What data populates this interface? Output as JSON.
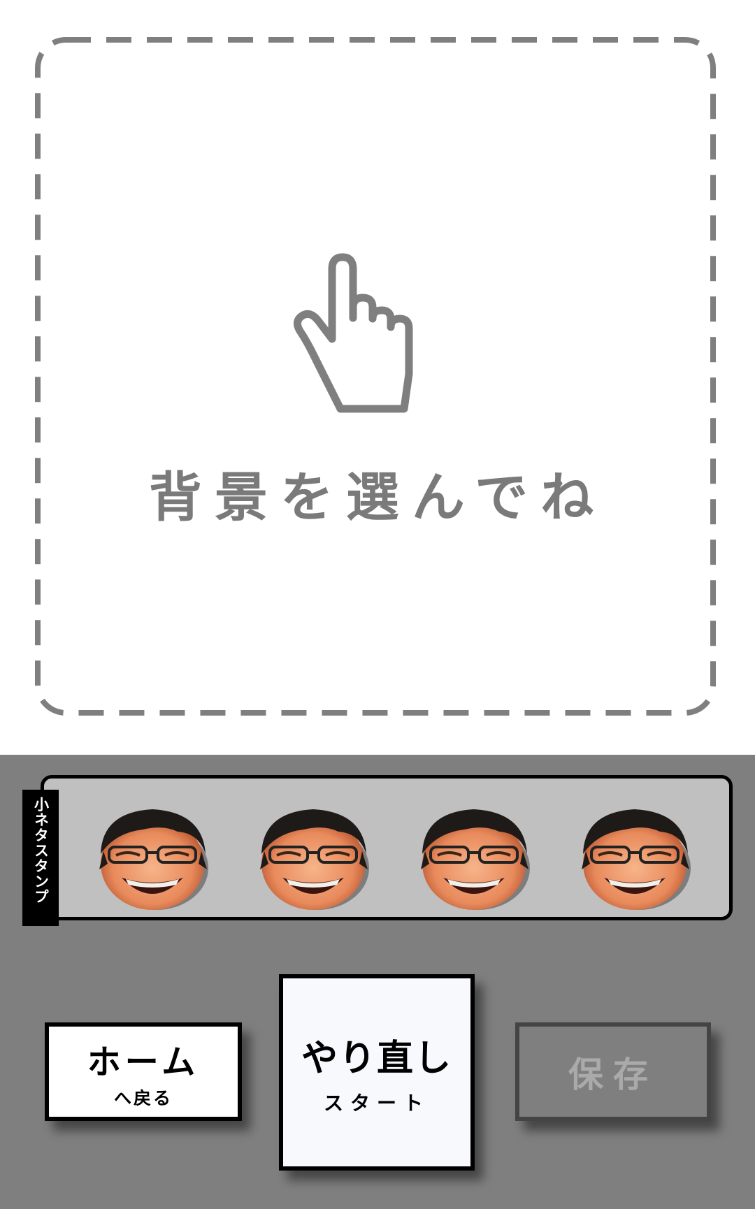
{
  "canvas": {
    "prompt": "背景を選んでね",
    "icon": "pointing-hand-icon"
  },
  "stamps": {
    "tab_label": "小ネタスタンプ",
    "items": [
      {
        "name": "laughing-face-stamp-1"
      },
      {
        "name": "laughing-face-stamp-2"
      },
      {
        "name": "laughing-face-stamp-3"
      },
      {
        "name": "laughing-face-stamp-4"
      }
    ]
  },
  "buttons": {
    "home": {
      "main": "ホーム",
      "sub": "へ戻る"
    },
    "redo": {
      "main": "やり直し",
      "sub": "スタート"
    },
    "save": {
      "main": "保存",
      "state": "disabled"
    }
  },
  "colors": {
    "bottom_bg": "#7f7f7f",
    "stamp_panel_bg": "#c0c0c0",
    "dashed_border": "#7f7f7f",
    "prompt_text": "#7a7a7a",
    "save_text_disabled": "#aaaaaa"
  }
}
